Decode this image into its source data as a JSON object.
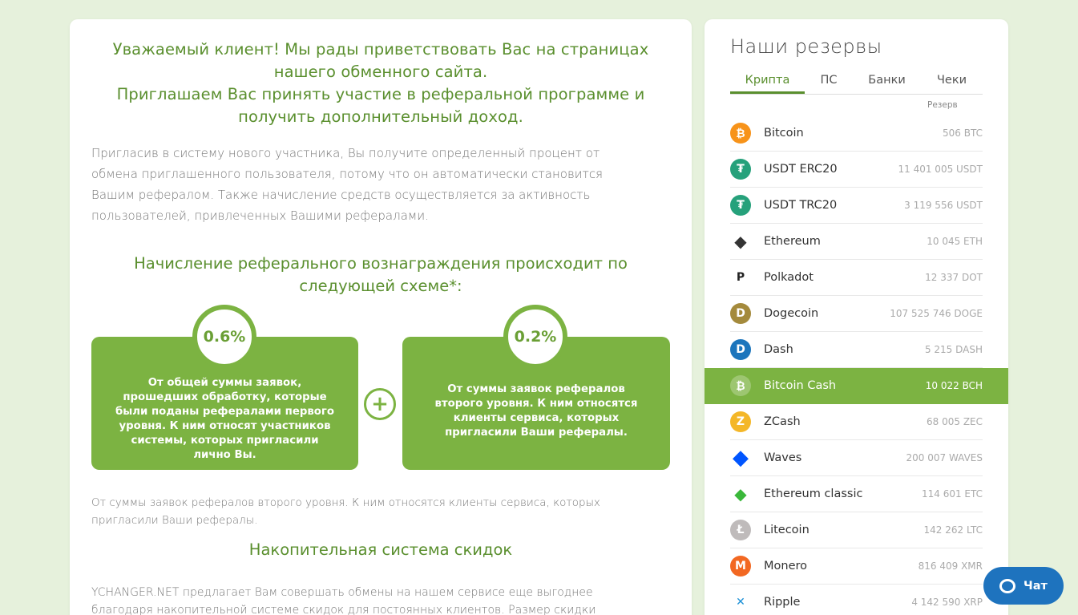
{
  "intro": {
    "headline_line1": "Уважаемый клиент! Мы рады приветствовать Вас на страницах нашего обменного сайта.",
    "headline_line2": "Приглашаем Вас принять участие в реферальной программе и получить дополнительный доход.",
    "paragraph": "Пригласив в систему нового участника, Вы получите определенный процент от обмена приглашенного пользователя, потому что он автоматически становится Вашим рефералом. Также начисление средств осуществляется за активность пользователей, привлеченных Вашими рефералами."
  },
  "scheme": {
    "title": "Начисление реферального вознаграждения происходит по следующей схеме*:",
    "level1": {
      "percent": "0.6%",
      "text": "От общей суммы заявок, прошедших обработку, которые были поданы рефералами первого уровня. К ним относят участников системы, которых пригласили лично Вы."
    },
    "plus": "+",
    "level2": {
      "percent": "0.2%",
      "text": "От суммы заявок рефералов второго уровня. К ним относятся клиенты сервиса, которых пригласили Ваши рефералы."
    },
    "note": "От суммы заявок рефералов второго уровня. К ним относятся клиенты сервиса, которых пригласили Ваши рефералы."
  },
  "discount": {
    "title": "Накопительная система скидок",
    "text": "YCHANGER.NET предлагает Вам совершать обмены на нашем сервисе еще выгоднее благодаря накопительной системе скидок для постоянных клиентов. Размер скидки определяется суммой"
  },
  "reserves": {
    "title": "Наши резервы",
    "tabs": [
      "Крипта",
      "ПС",
      "Банки",
      "Чеки"
    ],
    "reserve_label": "Резерв",
    "items": [
      {
        "name": "Bitcoin",
        "amount": "506 BTC",
        "icon": "bitcoin-icon",
        "color": "#f7931a",
        "glyph": "₿"
      },
      {
        "name": "USDT ERC20",
        "amount": "11 401 005 USDT",
        "icon": "tether-icon",
        "color": "#26a17b",
        "glyph": "₮"
      },
      {
        "name": "USDT TRC20",
        "amount": "3 119 556 USDT",
        "icon": "tether-icon",
        "color": "#26a17b",
        "glyph": "₮"
      },
      {
        "name": "Ethereum",
        "amount": "10 045 ETH",
        "icon": "ethereum-icon",
        "color": "#343434",
        "glyph": "◆"
      },
      {
        "name": "Polkadot",
        "amount": "12 337 DOT",
        "icon": "polkadot-icon",
        "color": "#ffffff",
        "glyph": "P"
      },
      {
        "name": "Dogecoin",
        "amount": "107 525 746 DOGE",
        "icon": "dogecoin-icon",
        "color": "#a48a3c",
        "glyph": "D"
      },
      {
        "name": "Dash",
        "amount": "5 215 DASH",
        "icon": "dash-icon",
        "color": "#1c75bc",
        "glyph": "D"
      },
      {
        "name": "Bitcoin Cash",
        "amount": "10 022 BCH",
        "icon": "bitcoin-cash-icon",
        "color": "#8dc351",
        "glyph": "₿"
      },
      {
        "name": "ZCash",
        "amount": "68 005 ZEC",
        "icon": "zcash-icon",
        "color": "#f4b728",
        "glyph": "Z"
      },
      {
        "name": "Waves",
        "amount": "200 007 WAVES",
        "icon": "waves-icon",
        "color": "#0055ff",
        "glyph": "◆"
      },
      {
        "name": "Ethereum classic",
        "amount": "114 601 ETC",
        "icon": "ethereum-classic-icon",
        "color": "#3ab83a",
        "glyph": "◆"
      },
      {
        "name": "Litecoin",
        "amount": "142 262 LTC",
        "icon": "litecoin-icon",
        "color": "#bfbbbb",
        "glyph": "Ł"
      },
      {
        "name": "Monero",
        "amount": "816 409 XMR",
        "icon": "monero-icon",
        "color": "#f26822",
        "glyph": "M"
      },
      {
        "name": "Ripple",
        "amount": "4 142 590 XRP",
        "icon": "ripple-icon",
        "color": "#ffffff",
        "glyph": "✕"
      }
    ],
    "active_index": 7
  },
  "chat": {
    "label": "Чат"
  },
  "colors": {
    "accent": "#7cb342",
    "heading": "#5a8f2e",
    "chat": "#1e73be",
    "background": "#e6f1dc"
  }
}
